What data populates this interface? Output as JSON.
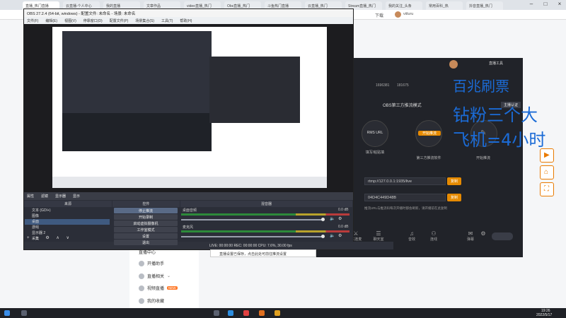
{
  "browser": {
    "tabs": [
      "直播_热门直播",
      "云直播-个人中心",
      "我的直播",
      "文章作品",
      "video直播_热门",
      "Obs直播_热门",
      "斗鱼热门直播",
      "云直播_热门",
      "Stream直播_热门",
      "我的关注_头条",
      "常用百科_热",
      "抖音直播_热门"
    ],
    "addr_suffix": "下载",
    "user_name": "viiluru"
  },
  "obs": {
    "title": "OBS 27.2.4 (64-bit, windows) - 配置文件: 未命名 - 场景: 未命名",
    "menu": [
      "文件(F)",
      "编辑(E)",
      "视图(V)",
      "停靠窗口(D)",
      "配置文件(P)",
      "场景集合(S)",
      "工具(T)",
      "帮助(H)"
    ],
    "toolbar": [
      "属性",
      "滤镜",
      "显示器",
      "显示"
    ],
    "dock_headers": [
      "来源",
      "控件",
      "混音器"
    ],
    "sources": [
      "文本 (GDI+)",
      "图像",
      "桌面",
      "游戏",
      "显示器 2",
      "采集"
    ],
    "controls": [
      "停止推流",
      "开始录制",
      "启动虚拟摄像机",
      "工作室模式",
      "设置",
      "退出"
    ],
    "mixer": [
      {
        "name": "桌面音频",
        "db": "0.0 dB"
      },
      {
        "name": "麦克风",
        "db": "0.0 dB"
      }
    ],
    "status": "LIVE: 00:00:00   REC: 00:00:00   CPU: 7.6%, 30.00 fps"
  },
  "stream": {
    "header_a": "直播工具",
    "header_b": "主播认证",
    "stats": [
      "1696381",
      "181675"
    ],
    "mode_title": "OBS第三方推流模式",
    "circle_a": "RMS URL",
    "circle_b": "开始推流",
    "circle_c": "",
    "sub_a": "填写/粘贴填",
    "sub_b": "第三方推流软件",
    "sub_c": "开始推流",
    "stream_url": "rtmp://127.0.0.1:1935/live",
    "stream_key": "04D4C449D48B",
    "copy_label": "复制",
    "hint": "推流URL与推流码每次开播时都会刷新，请开播前在此复制",
    "tools": [
      "PK连麦",
      "聊天室",
      "音效",
      "连线",
      "弹幕",
      "设置"
    ]
  },
  "handwriting": [
    "百兆刷票",
    "钻粉三个大",
    "飞机=4小时"
  ],
  "page_links": [
    "直播中心",
    "开播助手",
    "直播相关",
    "视频直播",
    "我的收藏"
  ],
  "badge": "NEW",
  "toast": "直播设置已保存，点击此处可前往推流设置",
  "taskbar": {
    "time": "19:26",
    "date": "2022/5/17"
  }
}
